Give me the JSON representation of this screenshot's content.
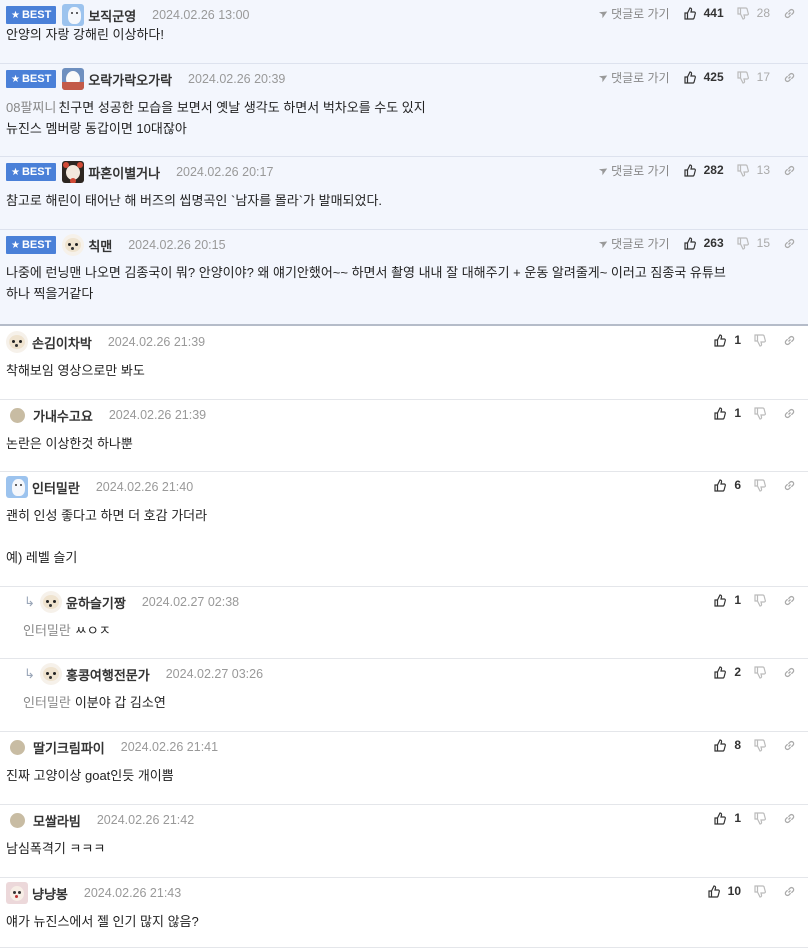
{
  "comments": [
    {
      "nick": "보직군영",
      "date": "2024.02.26 13:00",
      "best": true,
      "avatar": "blue",
      "up": "441",
      "down": "28",
      "goto": "댓글로 가기",
      "text": "안양의 자랑 강해린 이상하다!"
    },
    {
      "nick": "오락가락오가락",
      "date": "2024.02.26 20:39",
      "best": true,
      "avatar": "mix",
      "up": "425",
      "down": "17",
      "goto": "댓글로 가기",
      "prefix": "08팔찌니",
      "text": "친구면 성공한 모습을 보면서 옛날 생각도 하면서 벅차오를 수도 있지\n뉴진스 멤버랑 동갑이면 10대잖아"
    },
    {
      "nick": "파혼이별거나",
      "date": "2024.02.26 20:17",
      "best": true,
      "avatar": "red",
      "up": "282",
      "down": "13",
      "goto": "댓글로 가기",
      "text": "참고로 해린이 태어난 해 버즈의 씹명곡인 `남자를 몰라`가 발매되었다."
    },
    {
      "nick": "칙맨",
      "date": "2024.02.26 20:15",
      "best": true,
      "avatar": "dog",
      "up": "263",
      "down": "15",
      "goto": "댓글로 가기",
      "text": "나중에 런닝맨 나오면 김종국이 뭐? 안양이야? 왜 얘기안했어~~ 하면서 촬영 내내 잘 대해주기 + 운동 알려줄게~ 이러고 짐종국 유튜브\n하나 찍을거같다"
    },
    {
      "nick": "손김이차박",
      "date": "2024.02.26 21:39",
      "avatar": "dog",
      "up": "1",
      "text": "착해보임 영상으로만 봐도"
    },
    {
      "nick": "가내수고요",
      "date": "2024.02.26 21:39",
      "avatar": "dot",
      "up": "1",
      "text": "논란은 이상한것 하나뿐"
    },
    {
      "nick": "인터밀란",
      "date": "2024.02.26 21:40",
      "avatar": "blue",
      "up": "6",
      "text": "괜히 인성 좋다고 하면 더 호감 가더라\n\n예) 레벨 슬기"
    },
    {
      "nick": "윤하슬기짱",
      "date": "2024.02.27 02:38",
      "avatar": "dog",
      "reply": true,
      "mention": "인터밀란",
      "up": "1",
      "text": "ㅆㅇㅈ"
    },
    {
      "nick": "홍콩여행전문가",
      "date": "2024.02.27 03:26",
      "avatar": "dog",
      "reply": true,
      "mention": "인터밀란",
      "up": "2",
      "text": "이분야 갑 김소연"
    },
    {
      "nick": "딸기크림파이",
      "date": "2024.02.26 21:41",
      "avatar": "dot",
      "up": "8",
      "text": "진짜 고양이상 goat인듯 개이쁨"
    },
    {
      "nick": "모쌀라빔",
      "date": "2024.02.26 21:42",
      "avatar": "dot",
      "up": "1",
      "text": "남심폭격기 ㅋㅋㅋ"
    },
    {
      "nick": "냥냥봉",
      "date": "2024.02.26 21:43",
      "avatar": "pink",
      "up": "10",
      "text": "얘가 뉴진스에서 젤 인기 많지 않음?"
    }
  ],
  "labels": {
    "best": "BEST"
  },
  "icons": {
    "best": "star-icon",
    "up": "thumbs-up-icon",
    "down": "thumbs-down-icon",
    "share": "link-icon",
    "goto": "send-arrow-icon",
    "reply": "reply-arrow-icon"
  },
  "colors": {
    "best_badge": "#4a80d8",
    "best_bg": "#f3f6fd"
  }
}
